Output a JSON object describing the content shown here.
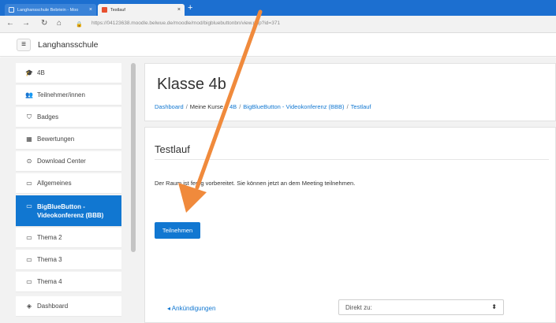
{
  "browser": {
    "tabs": [
      {
        "title": "Langhansschule Bebriein - Moo",
        "close": "×"
      },
      {
        "title": "Testlauf",
        "close": "×"
      }
    ],
    "new_tab": "+",
    "nav": {
      "back": "←",
      "forward": "→",
      "reload": "↻",
      "home": "⌂",
      "lock": "🔒"
    },
    "url_domain": "https://04123638.moodle.belwue.de",
    "url_path": "/moodle/mod/bigbluebuttonbn/view.php?id=371"
  },
  "navbar": {
    "menu": "≡",
    "site_name": "Langhansschule"
  },
  "drawer": {
    "items": [
      {
        "icon": "🎓",
        "label": "4B"
      },
      {
        "icon": "👥",
        "label": "Teilnehmer/innen"
      },
      {
        "icon": "⛉",
        "label": "Badges"
      },
      {
        "icon": "▦",
        "label": "Bewertungen"
      },
      {
        "icon": "⊙",
        "label": "Download Center"
      },
      {
        "icon": "▭",
        "label": "Allgemeines"
      },
      {
        "icon": "▭",
        "label": "BigBlueButton -\nVideokonferenz (BBB)",
        "active": true
      },
      {
        "icon": "▭",
        "label": "Thema 2"
      },
      {
        "icon": "▭",
        "label": "Thema 3"
      },
      {
        "icon": "▭",
        "label": "Thema 4"
      },
      {
        "icon": "◈",
        "label": "Dashboard"
      }
    ]
  },
  "header": {
    "title": "Klasse 4b",
    "breadcrumb": [
      "Dashboard",
      "Meine Kurse",
      "4B",
      "BigBlueButton - Videokonferenz (BBB)",
      "Testlauf"
    ],
    "separator": "/"
  },
  "main": {
    "activity_title": "Testlauf",
    "info": "Der Raum ist fertig vorbereitet. Sie können jetzt an dem Meeting teilnehmen.",
    "join_button": "Teilnehmen",
    "prev_link": "◂ Ankündigungen",
    "jump_select": "Direkt zu:",
    "jump_arrow": "⬍"
  },
  "colors": {
    "accent": "#1177d1",
    "browser_tabbar": "#1c6fd0",
    "annotation_arrow": "#f08a3c"
  }
}
